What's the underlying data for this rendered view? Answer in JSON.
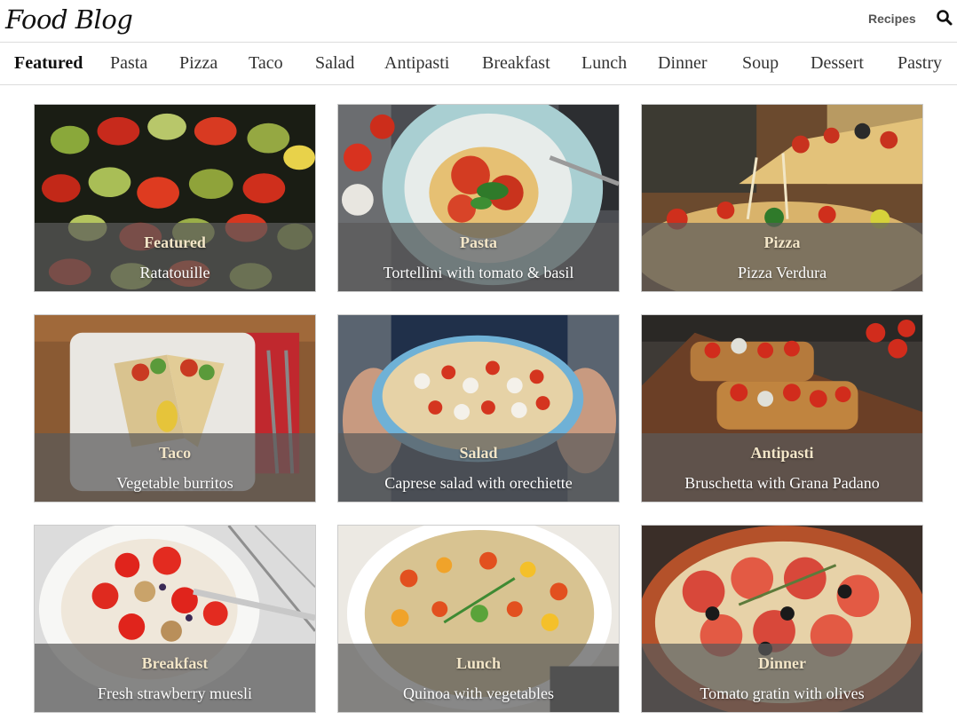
{
  "header": {
    "logo": "Food Blog",
    "recipes_label": "Recipes",
    "search_icon": "search-icon"
  },
  "nav": {
    "items": [
      {
        "label": "Featured",
        "active": true
      },
      {
        "label": "Pasta"
      },
      {
        "label": "Pizza"
      },
      {
        "label": "Taco"
      },
      {
        "label": "Salad"
      },
      {
        "label": "Antipasti"
      },
      {
        "label": "Breakfast"
      },
      {
        "label": "Lunch"
      },
      {
        "label": "Dinner"
      },
      {
        "label": "Soup"
      },
      {
        "label": "Dessert"
      },
      {
        "label": "Pastry"
      }
    ]
  },
  "cards": [
    {
      "category": "Featured",
      "title": "Ratatouille",
      "image": "ratatouille-photo"
    },
    {
      "category": "Pasta",
      "title": "Tortellini with tomato & basil",
      "image": "tortellini-photo"
    },
    {
      "category": "Pizza",
      "title": "Pizza Verdura",
      "image": "pizza-photo"
    },
    {
      "category": "Taco",
      "title": "Vegetable burritos",
      "image": "burritos-photo"
    },
    {
      "category": "Salad",
      "title": "Caprese salad with orechiette",
      "image": "salad-photo"
    },
    {
      "category": "Antipasti",
      "title": "Bruschetta with Grana Padano",
      "image": "bruschetta-photo"
    },
    {
      "category": "Breakfast",
      "title": "Fresh strawberry muesli",
      "image": "muesli-photo"
    },
    {
      "category": "Lunch",
      "title": "Quinoa with vegetables",
      "image": "quinoa-photo"
    },
    {
      "category": "Dinner",
      "title": "Tomato gratin with olives",
      "image": "gratin-photo"
    }
  ],
  "colors": {
    "overlay": "#5a5a5a",
    "category_text": "#f3e6c8",
    "border": "#dcdcdc"
  }
}
